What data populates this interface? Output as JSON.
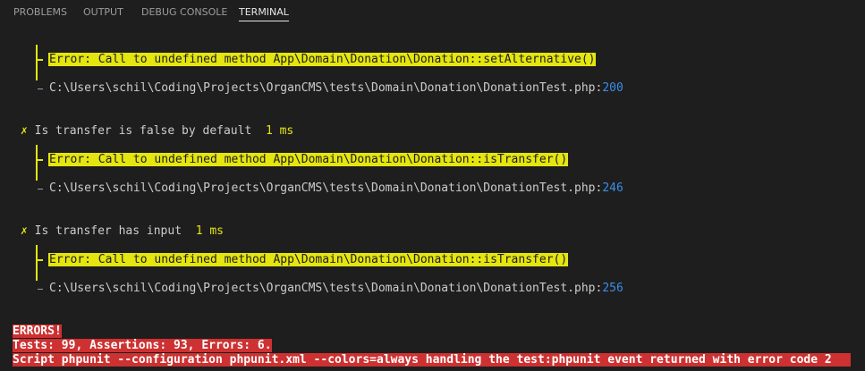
{
  "panel_tabs": [
    {
      "label": "PROBLEMS"
    },
    {
      "label": "OUTPUT"
    },
    {
      "label": "DEBUG CONSOLE"
    },
    {
      "label": "TERMINAL"
    }
  ],
  "active_tab": "TERMINAL",
  "terminal": {
    "errors": [
      {
        "message": "Error: Call to undefined method App\\Domain\\Donation\\Donation::setAlternative()",
        "file": "C:\\Users\\schil\\Coding\\Projects\\OrganCMS\\tests\\Domain\\Donation\\DonationTest.php:",
        "line_no": "200"
      },
      {
        "test_mark": "✗",
        "test_name": "Is transfer is false by default",
        "duration": "1 ms",
        "message": "Error: Call to undefined method App\\Domain\\Donation\\Donation::isTransfer()",
        "file": "C:\\Users\\schil\\Coding\\Projects\\OrganCMS\\tests\\Domain\\Donation\\DonationTest.php:",
        "line_no": "246"
      },
      {
        "test_mark": "✗",
        "test_name": "Is transfer has input",
        "duration": "1 ms",
        "message": "Error: Call to undefined method App\\Domain\\Donation\\Donation::isTransfer()",
        "file": "C:\\Users\\schil\\Coding\\Projects\\OrganCMS\\tests\\Domain\\Donation\\DonationTest.php:",
        "line_no": "256"
      }
    ],
    "summary": {
      "errors_label": "ERRORS!",
      "tests_line": "Tests: 99, Assertions: 93, Errors: 6.",
      "script_line": "Script phpunit --configuration phpunit.xml --colors=always handling the test:phpunit event returned with error code 2"
    },
    "colors": {
      "background": "#1e1e1e",
      "foreground": "#cccccc",
      "yellow": "#e5e510",
      "red": "#cd3131",
      "blue": "#3b8eea"
    }
  }
}
